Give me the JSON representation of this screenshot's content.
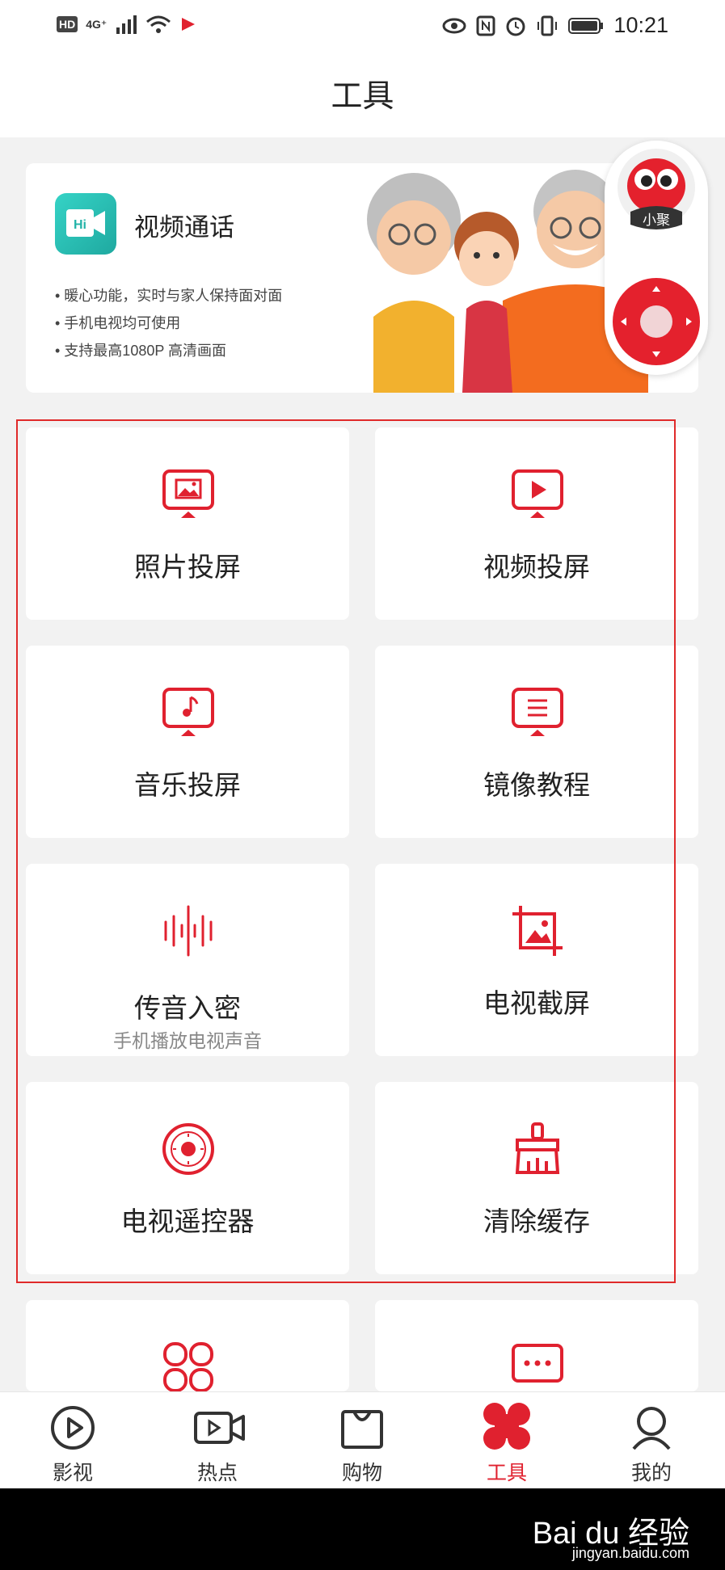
{
  "status_bar": {
    "time": "10:21",
    "left_labels": [
      "HD",
      "4G⁺"
    ]
  },
  "header": {
    "title": "工具"
  },
  "banner": {
    "logo_text": "Hi",
    "title": "视频通话",
    "features": [
      "• 暖心功能，实时与家人保持面对面",
      "• 手机电视均可使用",
      "• 支持最高1080P 高清画面"
    ]
  },
  "floating": {
    "mascot_label": "小聚"
  },
  "tools": [
    {
      "label": "照片投屏",
      "sub": ""
    },
    {
      "label": "视频投屏",
      "sub": ""
    },
    {
      "label": "音乐投屏",
      "sub": ""
    },
    {
      "label": "镜像教程",
      "sub": ""
    },
    {
      "label": "传音入密",
      "sub": "手机播放电视声音"
    },
    {
      "label": "电视截屏",
      "sub": ""
    },
    {
      "label": "电视遥控器",
      "sub": ""
    },
    {
      "label": "清除缓存",
      "sub": ""
    }
  ],
  "bottom_nav": [
    {
      "label": "影视",
      "icon": "play-circle-icon"
    },
    {
      "label": "热点",
      "icon": "video-camera-icon"
    },
    {
      "label": "购物",
      "icon": "shopping-bag-icon"
    },
    {
      "label": "工具",
      "icon": "four-leaf-icon"
    },
    {
      "label": "我的",
      "icon": "person-icon"
    }
  ],
  "watermark": {
    "brand": "Bai du 经验",
    "url": "jingyan.baidu.com"
  },
  "colors": {
    "accent": "#e0212f",
    "teal": "#2bbfb3"
  }
}
